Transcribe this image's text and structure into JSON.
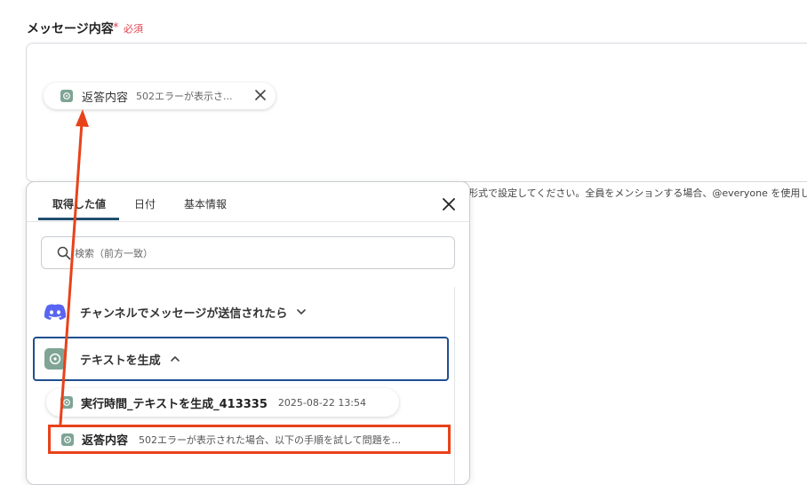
{
  "field": {
    "label": "メッセージ内容",
    "required_star": "*",
    "required_text": "必須"
  },
  "message_chip": {
    "label": "返答内容",
    "value": "502エラーが表示さ..."
  },
  "hint": "形式で設定してください。全員をメンションする場合、@everyone を使用します",
  "popover": {
    "tabs": [
      "取得した値",
      "日付",
      "基本情報"
    ],
    "active_tab": "取得した値",
    "search_placeholder": "検索（前方一致）",
    "groups": [
      {
        "label": "チャンネルでメッセージが送信されたら",
        "icon": "discord-icon",
        "expanded": false
      },
      {
        "label": "テキストを生成",
        "icon": "chatgpt-icon",
        "expanded": true
      }
    ],
    "items": [
      {
        "label": "実行時間_テキストを生成_413335",
        "value": "2025-08-22 13:54"
      },
      {
        "label": "返答内容",
        "value": "502エラーが表示された場合、以下の手順を試して問題を..."
      }
    ]
  },
  "colors": {
    "accent_blue": "#1f4f8f",
    "highlight_red": "#e8421a",
    "required_red": "#e0434f",
    "discord": "#5865f2",
    "chatgpt": "#7fa495"
  }
}
